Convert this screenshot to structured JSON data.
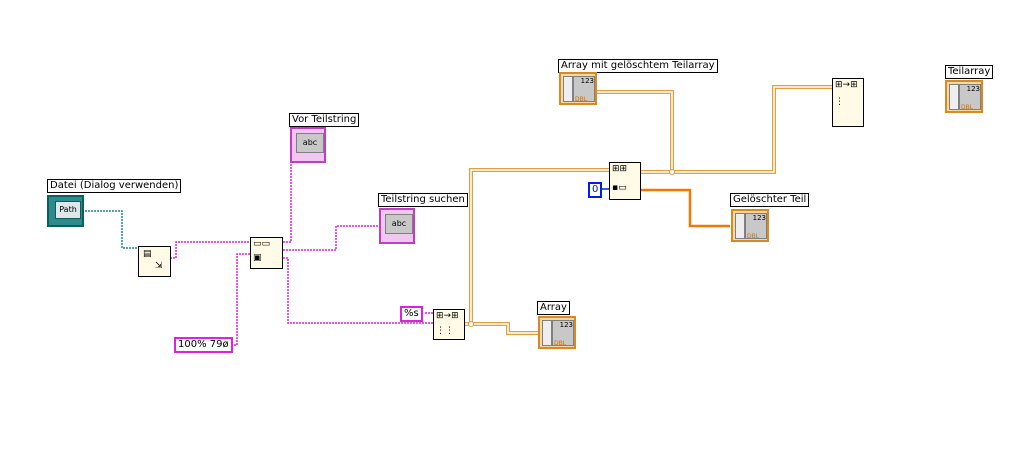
{
  "labels": {
    "datei": "Datei (Dialog verwenden)",
    "vor_teilstring": "Vor Teilstring",
    "teilstring_suchen": "Teilstring suchen",
    "array_mit_geloeschtem": "Array mit gelöschtem Teilarray",
    "geloeschter_teil": "Gelöschter Teil",
    "teilarray": "Teilarray",
    "array": "Array"
  },
  "constants": {
    "search_string": "100% 79ø",
    "format_string": "%s",
    "index": "0"
  },
  "terminal_text": {
    "path": "Path",
    "string_display": "abc",
    "array_value": "123",
    "array_type": "DBL"
  },
  "colors": {
    "string_wire": "#e020e0",
    "path_wire": "#1e8c8c",
    "array_wire": "#e0a040",
    "dbl_wire": "#f07800"
  }
}
